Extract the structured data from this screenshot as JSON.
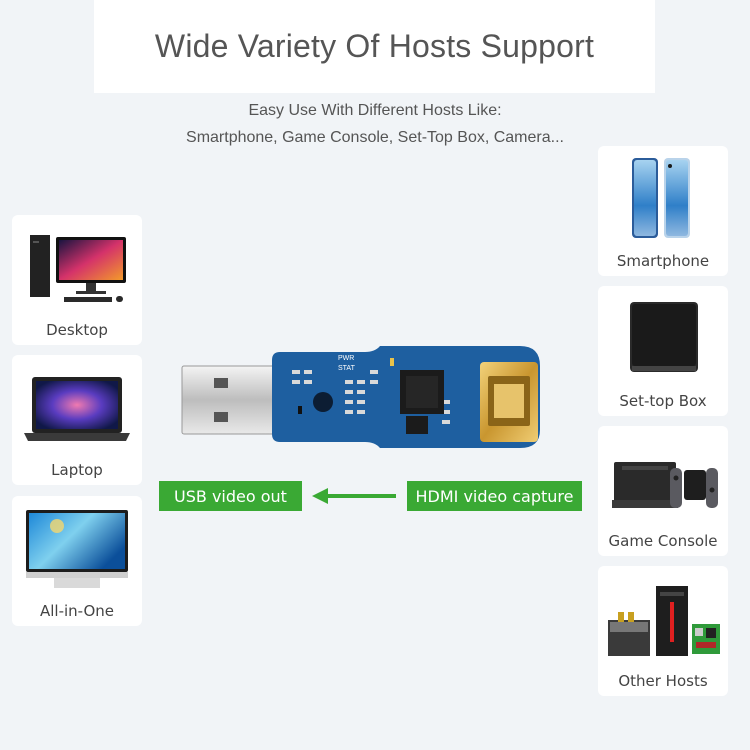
{
  "header": {
    "title": "Wide Variety Of Hosts Support",
    "subtitle_line1": "Easy Use With Different Hosts Like:",
    "subtitle_line2": "Smartphone, Game Console, Set-Top Box, Camera..."
  },
  "left_hosts": [
    {
      "label": "Desktop",
      "icon": "desktop-pc-icon"
    },
    {
      "label": "Laptop",
      "icon": "laptop-icon"
    },
    {
      "label": "All-in-One",
      "icon": "all-in-one-pc-icon"
    }
  ],
  "right_hosts": [
    {
      "label": "Smartphone",
      "icon": "smartphone-icon"
    },
    {
      "label": "Set-top Box",
      "icon": "set-top-box-icon"
    },
    {
      "label": "Game Console",
      "icon": "game-console-icon"
    },
    {
      "label": "Other Hosts",
      "icon": "other-hosts-icon"
    }
  ],
  "device": {
    "name": "USB HDMI capture dongle",
    "silkscreen": [
      "PWR",
      "STAT"
    ]
  },
  "flow": {
    "output_label": "USB video out",
    "input_label": "HDMI video capture",
    "arrow_direction": "left",
    "accent_color": "#3aa934"
  }
}
